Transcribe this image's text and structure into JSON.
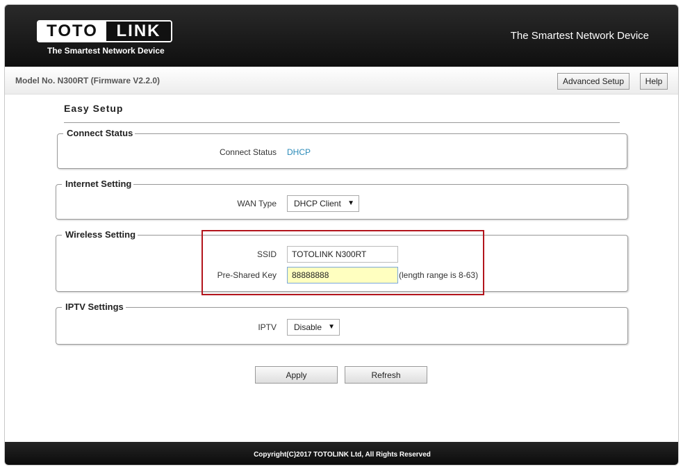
{
  "header": {
    "logo_left": "TOTO",
    "logo_right": "LINK",
    "logo_tagline": "The Smartest Network Device",
    "slogan": "The Smartest Network Device"
  },
  "topbar": {
    "model": "Model No. N300RT (Firmware V2.2.0)",
    "advanced_label": "Advanced Setup",
    "help_label": "Help"
  },
  "page": {
    "title": "Easy Setup"
  },
  "connect_status": {
    "legend": "Connect Status",
    "label": "Connect Status",
    "value": "DHCP"
  },
  "internet": {
    "legend": "Internet Setting",
    "wan_label": "WAN Type",
    "wan_value": "DHCP Client"
  },
  "wireless": {
    "legend": "Wireless Setting",
    "ssid_label": "SSID",
    "ssid_value": "TOTOLINK N300RT",
    "psk_label": "Pre-Shared Key",
    "psk_value": "88888888",
    "psk_hint": "(length range is 8-63)"
  },
  "iptv": {
    "legend": "IPTV Settings",
    "label": "IPTV",
    "value": "Disable"
  },
  "actions": {
    "apply": "Apply",
    "refresh": "Refresh"
  },
  "footer": {
    "copyright": "Copyright(C)2017 TOTOLINK Ltd, All Rights Reserved"
  }
}
